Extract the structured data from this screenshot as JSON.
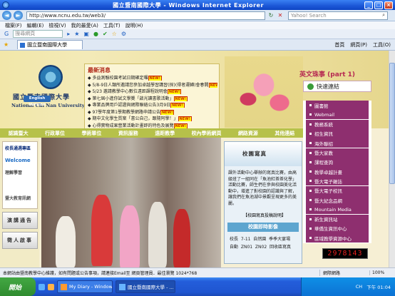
{
  "window": {
    "title": "國立暨南國際大學 - Windows Internet Explorer",
    "min": "_",
    "max": "□",
    "close": "×"
  },
  "address": {
    "url": "http://www.ncnu.edu.tw/web3/",
    "search_placeholder": "Yahoo! Search"
  },
  "menu": [
    "檔案(F)",
    "編輯(E)",
    "檢視(V)",
    "我的最愛(A)",
    "工具(T)",
    "說明(H)"
  ],
  "toolbar": {
    "search_placeholder": "搜尋網頁"
  },
  "tab": {
    "label": "國立暨南國際大學",
    "tools": [
      "首頁",
      "網頁(P)",
      "工具(O)"
    ]
  },
  "header": {
    "logo_cn": "國立暨南國際大學",
    "logo_en": "National Chi Nan University",
    "english_version": "English Version",
    "news_title": "最新消息",
    "news": [
      "多益測驗校園考試日期確定囉",
      "5/8-9日人類所邀請您參加卓越學習講習(探)(得者運轉)會春開",
      "5/23 邀請教學中心數位遠距課程說明會",
      "第七屆小進你試文學獎「啟光讀書歌活動」",
      "專業品牌用戶認證與網際聯絡公告3月9日",
      "97學年度第1學期教學網路申請公告",
      "期中文化學生質案「書公自己，跟隨阿學！」",
      "心得實物成果營業活動計畫即的特色及展覽"
    ],
    "new_badge": "NEW!",
    "eng_title": "英文珠事 (part 1)",
    "quick_title": "快速連結"
  },
  "nav": [
    "認識暨大",
    "行政單位",
    "學術單位",
    "資訊服務",
    "遠距教學",
    "校內學術網頁",
    "網路資源",
    "其他連結"
  ],
  "quick_links": [
    "圖書館",
    "Webmail",
    "教務系統",
    "招生資訊",
    "海外聯招",
    "暨大家教",
    "課程查詢",
    "教學卓越計畫",
    "暨大電子雜誌",
    "暨大電子校訊",
    "暨大紀念品網",
    "Mountain Media",
    "新生資訊站",
    "華僑生資訊中心",
    "區域教學資源中心"
  ],
  "left": {
    "ad_title": "校長通週專區",
    "ad_sub": "Welcome",
    "ad_text": "理解學習",
    "ad_tag": "暨大教育訊網",
    "btn1": "演講通告",
    "btn2": "徵人啟事"
  },
  "campus": {
    "title": "校園寫真",
    "text": "課外活動中心舉辦的寫真比賽，由高級班了一組同在「魚池紅茶茶化學」活動比賽，師生們在參與校園美化活動中，增進了對校園的認識與了解，讓我們在魚池湖中景觀呈現更多的美麗。",
    "link": "【校園寫真投稿說明】",
    "video": "校園即時影像",
    "row1": [
      "校長",
      "7-11",
      "自然園",
      "季季大宴場"
    ],
    "row2": [
      "自動",
      "ZN01",
      "ZN02",
      "回收區寫真"
    ]
  },
  "counter": "2978143",
  "status": {
    "message": "本網站由暨南教學中心維護，如有問題或公告事項，請連接Email至 網頁管理員．最佳瀏覽 1024*768",
    "zone": "網際網路",
    "zoom": "100%"
  },
  "taskbar": {
    "start": "開始",
    "tasks": [
      "My Diary - Windows I...",
      "國立暨南國際大學 - ..."
    ],
    "tray": [
      "CH",
      "下午 01:04"
    ]
  }
}
